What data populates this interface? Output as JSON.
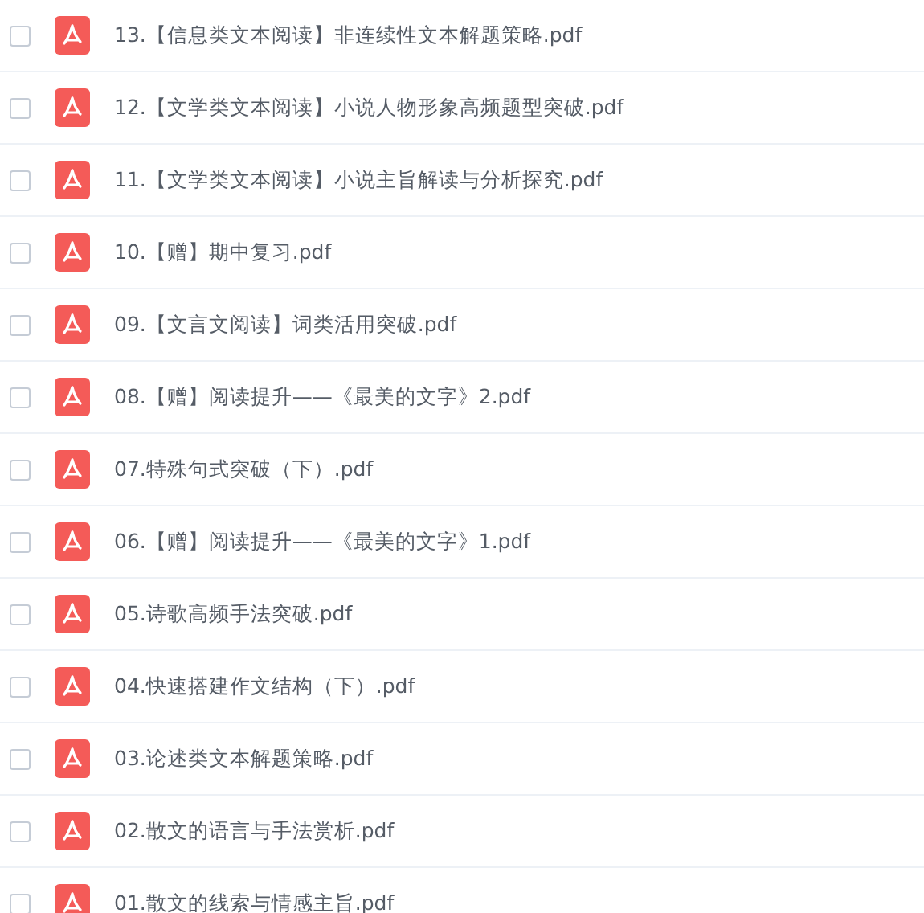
{
  "files": [
    {
      "name": "13.【信息类文本阅读】非连续性文本解题策略.pdf",
      "checked": false
    },
    {
      "name": "12.【文学类文本阅读】小说人物形象高频题型突破.pdf",
      "checked": false
    },
    {
      "name": "11.【文学类文本阅读】小说主旨解读与分析探究.pdf",
      "checked": false
    },
    {
      "name": "10.【赠】期中复习.pdf",
      "checked": false
    },
    {
      "name": "09.【文言文阅读】词类活用突破.pdf",
      "checked": false
    },
    {
      "name": "08.【赠】阅读提升——《最美的文字》2.pdf",
      "checked": false
    },
    {
      "name": "07.特殊句式突破（下）.pdf",
      "checked": false
    },
    {
      "name": "06.【赠】阅读提升——《最美的文字》1.pdf",
      "checked": false
    },
    {
      "name": "05.诗歌高频手法突破.pdf",
      "checked": false
    },
    {
      "name": "04.快速搭建作文结构（下）.pdf",
      "checked": false
    },
    {
      "name": "03.论述类文本解题策略.pdf",
      "checked": false
    },
    {
      "name": "02.散文的语言与手法赏析.pdf",
      "checked": false
    },
    {
      "name": "01.散文的线索与情感主旨.pdf",
      "checked": false
    }
  ]
}
